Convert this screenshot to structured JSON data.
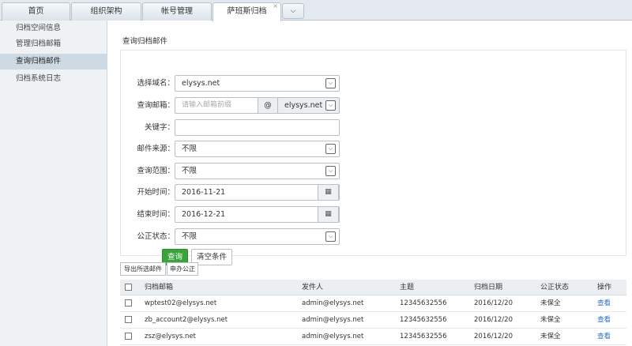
{
  "tabs": [
    {
      "label": "首页"
    },
    {
      "label": "组织架构"
    },
    {
      "label": "帐号管理"
    },
    {
      "label": "萨班斯归档",
      "close": "×"
    }
  ],
  "tab_dropdown": "⌵",
  "sidebar": {
    "items": [
      {
        "label": "归档空间信息"
      },
      {
        "label": "管理归档邮箱"
      },
      {
        "label": "查询归档邮件"
      },
      {
        "label": "归档系统日志"
      }
    ]
  },
  "search": {
    "title": "查询归档邮件",
    "domain_label": "选择域名：",
    "domain_value": "elysys.net",
    "mailbox_label": "查询邮箱：",
    "mailbox_placeholder": "请输入邮箱前缀",
    "at_symbol": "@",
    "mailbox_domain": "elysys.net",
    "keyword_label": "关键字：",
    "keyword_value": "",
    "source_label": "邮件来源：",
    "source_value": "不限",
    "scope_label": "查询范围：",
    "scope_value": "不限",
    "start_label": "开始时间：",
    "start_value": "2016-11-21",
    "end_label": "结束时间：",
    "end_value": "2016-12-21",
    "notary_label": "公正状态：",
    "notary_value": "不限",
    "query_button": "查询",
    "clear_button": "清空条件"
  },
  "toolbar": {
    "export_label": "导出所选邮件",
    "notary_label": "申办公正"
  },
  "table": {
    "headers": {
      "mailbox": "归档邮箱",
      "sender": "发件人",
      "subject": "主题",
      "date": "归档日期",
      "status": "公正状态",
      "action": "操作"
    },
    "rows": [
      {
        "mailbox": "wptest02@elysys.net",
        "sender": "admin@elysys.net",
        "subject": "12345632556",
        "date": "2016/12/20",
        "status": "未保全",
        "action": "查看"
      },
      {
        "mailbox": "zb_account2@elysys.net",
        "sender": "admin@elysys.net",
        "subject": "12345632556",
        "date": "2016/12/20",
        "status": "未保全",
        "action": "查看"
      },
      {
        "mailbox": "zsz@elysys.net",
        "sender": "admin@elysys.net",
        "subject": "12345632556",
        "date": "2016/12/20",
        "status": "未保全",
        "action": "查看"
      }
    ]
  },
  "icons": {
    "select_arrow": "⌵",
    "calendar": "▦"
  },
  "colors": {
    "primary_button": "#3aa43a",
    "link": "#2a6fc9",
    "sidebar_active": "#cdd9e3"
  }
}
